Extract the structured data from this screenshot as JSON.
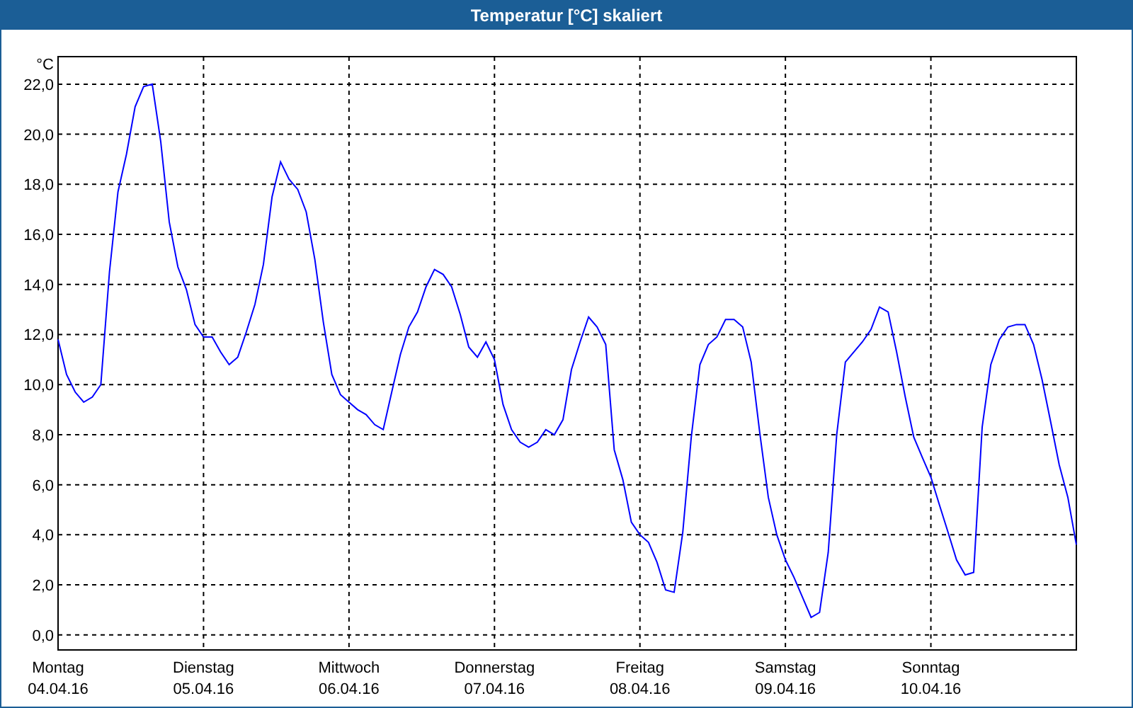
{
  "window": {
    "title": "Temperatur [°C] skaliert"
  },
  "chart_data": {
    "type": "line",
    "grid": true,
    "ylabel": "°C",
    "ylim": [
      -0.6,
      23.1
    ],
    "yticks": [
      {
        "value": 0,
        "label": "0,0"
      },
      {
        "value": 2,
        "label": "2,0"
      },
      {
        "value": 4,
        "label": "4,0"
      },
      {
        "value": 6,
        "label": "6,0"
      },
      {
        "value": 8,
        "label": "8,0"
      },
      {
        "value": 10,
        "label": "10,0"
      },
      {
        "value": 12,
        "label": "12,0"
      },
      {
        "value": 14,
        "label": "14,0"
      },
      {
        "value": 16,
        "label": "16,0"
      },
      {
        "value": 18,
        "label": "18,0"
      },
      {
        "value": 20,
        "label": "20,0"
      },
      {
        "value": 22,
        "label": "22,0"
      }
    ],
    "categories": [
      "Montag\n04.04.16",
      null,
      null,
      null,
      null,
      null,
      null,
      null,
      null,
      null,
      null,
      null,
      null,
      null,
      null,
      null,
      null,
      "Dienstag\n05.04.16",
      null,
      null,
      null,
      null,
      null,
      null,
      null,
      null,
      null,
      null,
      null,
      null,
      null,
      null,
      null,
      null,
      "Mittwoch\n06.04.16",
      null,
      null,
      null,
      null,
      null,
      null,
      null,
      null,
      null,
      null,
      null,
      null,
      null,
      null,
      null,
      null,
      "Donnerstag\n07.04.16",
      null,
      null,
      null,
      null,
      null,
      null,
      null,
      null,
      null,
      null,
      null,
      null,
      null,
      null,
      null,
      null,
      "Freitag\n08.04.16",
      null,
      null,
      null,
      null,
      null,
      null,
      null,
      null,
      null,
      null,
      null,
      null,
      null,
      null,
      null,
      null,
      "Samstag\n09.04.16",
      null,
      null,
      null,
      null,
      null,
      null,
      null,
      null,
      null,
      null,
      null,
      null,
      null,
      null,
      null,
      null,
      "Sonntag\n10.04.16",
      null,
      null,
      null,
      null,
      null,
      null,
      null,
      null,
      null,
      null,
      null,
      null,
      null,
      null,
      null,
      null,
      null
    ],
    "series": [
      {
        "color": "#0000ff",
        "values": [
          11.8,
          10.4,
          9.7,
          9.3,
          9.5,
          10.0,
          14.5,
          17.7,
          19.2,
          21.1,
          21.9,
          22.0,
          19.7,
          16.5,
          14.7,
          13.8,
          12.4,
          11.9,
          11.9,
          11.3,
          10.8,
          11.1,
          12.1,
          13.2,
          14.8,
          17.5,
          18.9,
          18.2,
          17.8,
          16.9,
          15.0,
          12.5,
          10.4,
          9.6,
          9.3,
          9.0,
          8.8,
          8.4,
          8.2,
          9.7,
          11.2,
          12.3,
          12.9,
          13.9,
          14.6,
          14.4,
          13.9,
          12.8,
          11.5,
          11.1,
          11.7,
          11.0,
          9.2,
          8.2,
          7.7,
          7.5,
          7.7,
          8.2,
          8.0,
          8.6,
          10.6,
          11.7,
          12.7,
          12.3,
          11.6,
          7.4,
          6.2,
          4.5,
          4.0,
          3.7,
          2.9,
          1.8,
          1.7,
          4.1,
          7.9,
          10.8,
          11.6,
          11.9,
          12.6,
          12.6,
          12.3,
          10.9,
          8.1,
          5.5,
          4.0,
          3.0,
          2.3,
          1.5,
          0.7,
          0.9,
          3.3,
          8.0,
          10.9,
          11.3,
          11.7,
          12.2,
          13.1,
          12.9,
          11.3,
          9.5,
          7.9,
          7.1,
          6.3,
          5.2,
          4.1,
          3.0,
          2.4,
          2.5,
          8.3,
          10.8,
          11.8,
          12.3,
          12.4,
          12.4,
          11.6,
          10.2,
          8.5,
          6.8,
          5.5,
          3.6
        ]
      }
    ]
  }
}
